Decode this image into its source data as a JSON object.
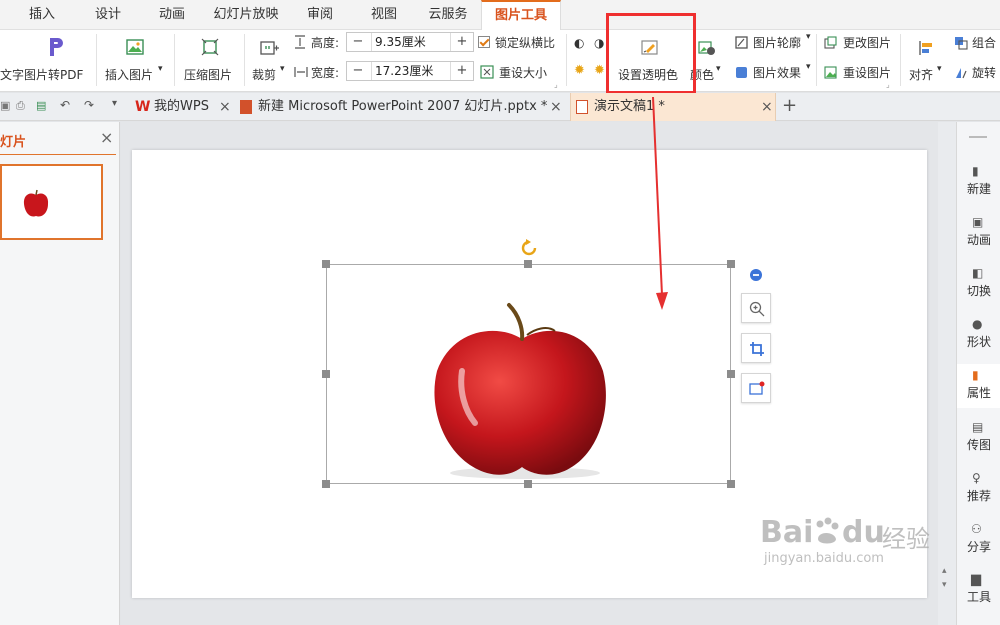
{
  "menu": {
    "tabs": [
      "插入",
      "设计",
      "动画",
      "幻灯片放映",
      "审阅",
      "视图",
      "云服务",
      "图片工具"
    ],
    "active_tab": "图片工具",
    "accent_color": "#e36c1c"
  },
  "ribbon": {
    "text_partial": "文字",
    "pic_to_pdf": "图片转PDF",
    "insert_picture": "插入图片",
    "compress_picture": "压缩图片",
    "crop": "裁剪",
    "height_label": "高度:",
    "height_value": "9.35厘米",
    "width_label": "宽度:",
    "width_value": "17.23厘米",
    "minus": "−",
    "plus": "+",
    "lock_ratio": "锁定纵横比",
    "reset_size": "重设大小",
    "set_transparent": "设置透明色",
    "color": "颜色",
    "picture_outline": "图片轮廓",
    "picture_effect": "图片效果",
    "change_picture": "更改图片",
    "reset_picture": "重设图片",
    "align": "对齐",
    "group": "组合",
    "rotate": "旋转",
    "highlight_color": "#ef2f2f"
  },
  "tabs": {
    "my_wps": "我的WPS",
    "doc1": "新建 Microsoft PowerPoint 2007 幻灯片.pptx *",
    "doc2": "演示文稿1 *",
    "close": "×",
    "new_tab": "+"
  },
  "left_panel": {
    "title": "灯片",
    "close": "×"
  },
  "right_sidebar": {
    "items": [
      "新建",
      "动画",
      "切换",
      "形状",
      "属性",
      "传图",
      "推荐",
      "分享",
      "工具"
    ],
    "active": "属性"
  },
  "watermark": {
    "brand": "Bai",
    "brand2": "du",
    "cn": "经验",
    "url": "jingyan.baidu.com"
  }
}
